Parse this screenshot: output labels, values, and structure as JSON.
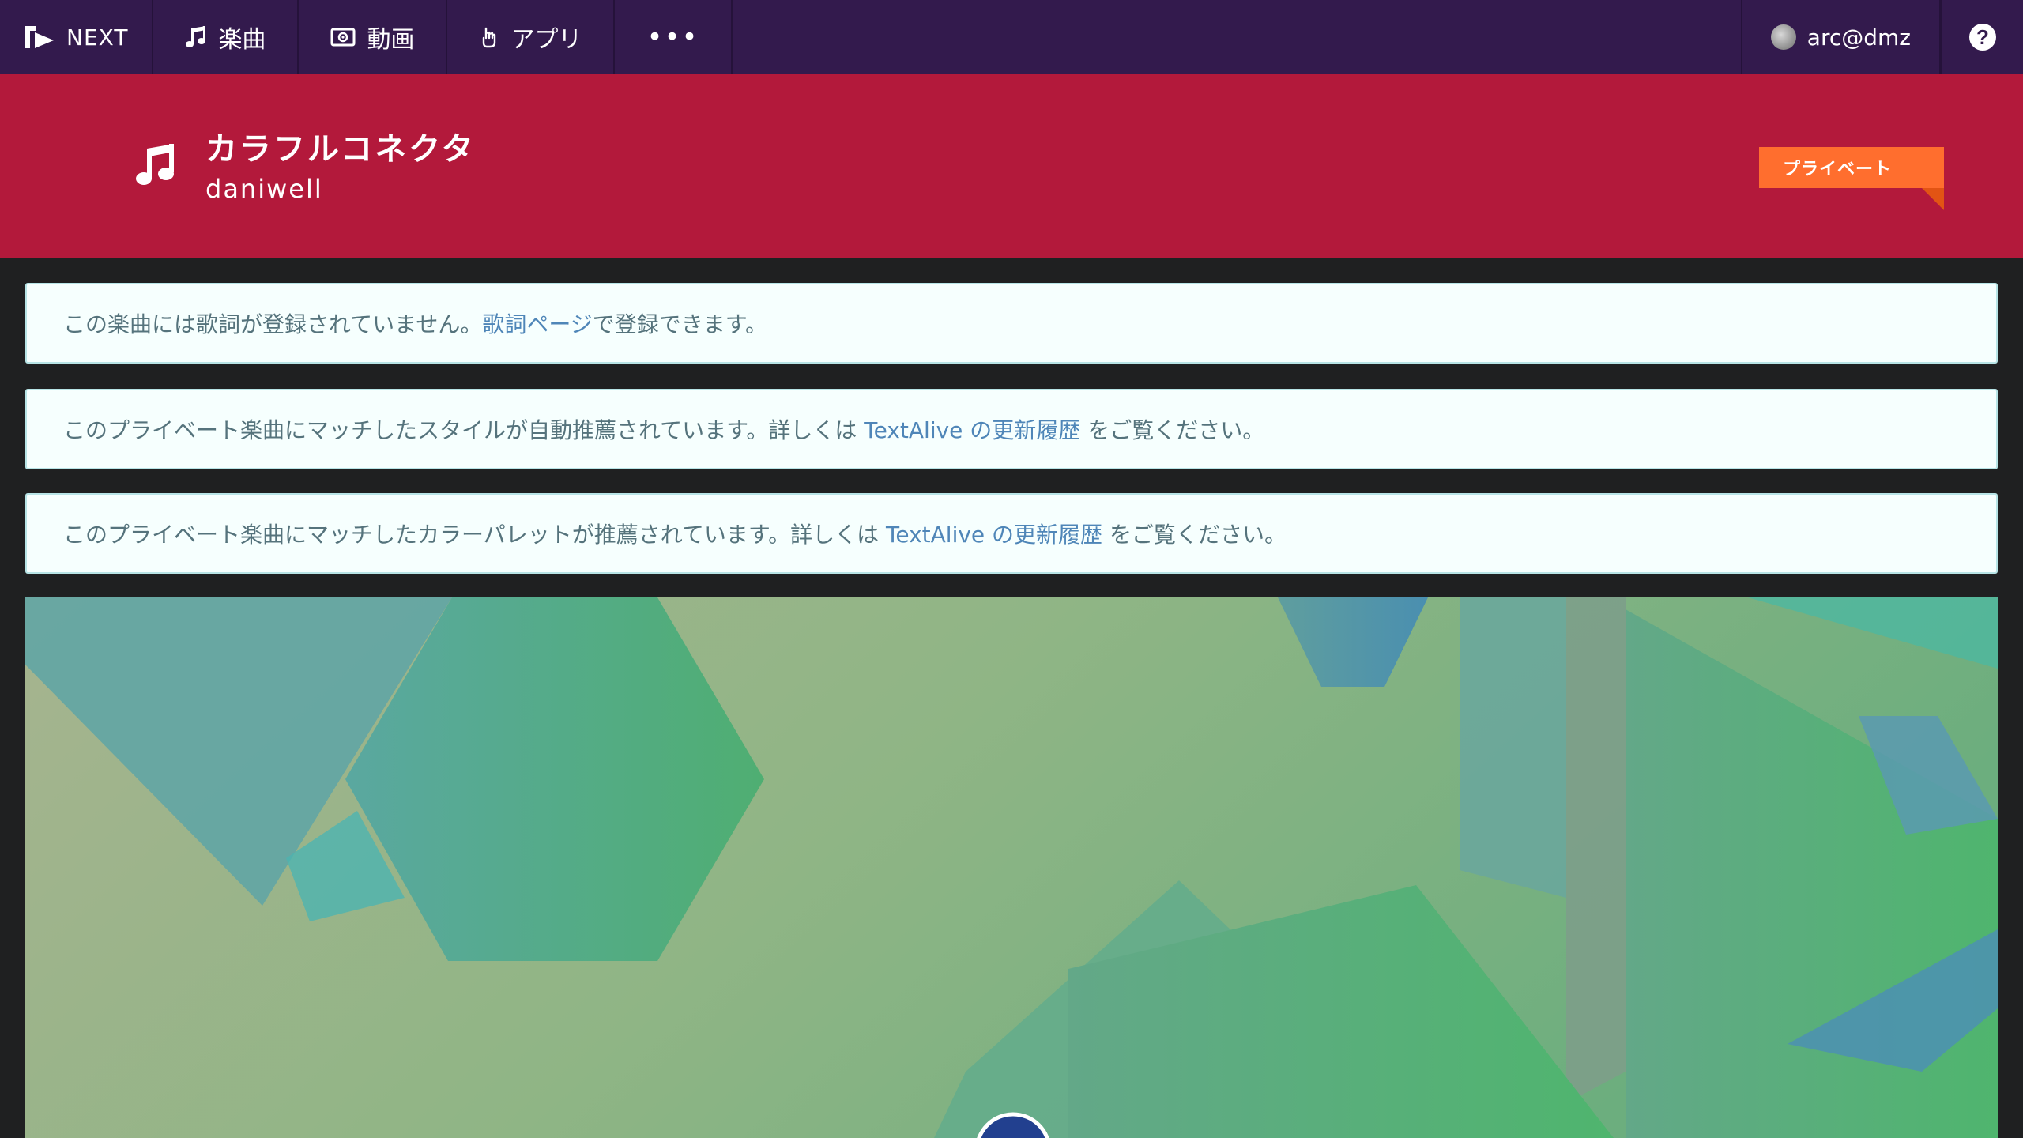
{
  "nav": {
    "brand_label": "NEXT",
    "songs_label": "楽曲",
    "videos_label": "動画",
    "apps_label": "アプリ",
    "more_label": "•••",
    "user_name": "arc@dmz",
    "help_label": "?"
  },
  "song": {
    "title": "カラフルコネクタ",
    "artist": "daniwell",
    "badge": "プライベート"
  },
  "notices": [
    {
      "before": "この楽曲には歌詞が登録されていません。",
      "link": "歌詞ページ",
      "after": "で登録できます。"
    },
    {
      "before": "このプライベート楽曲にマッチしたスタイルが自動推薦されています。詳しくは ",
      "link": "TextAlive の更新履歴",
      "after": " をご覧ください。"
    },
    {
      "before": "このプライベート楽曲にマッチしたカラーパレットが推薦されています。詳しくは ",
      "link": "TextAlive の更新履歴",
      "after": " をご覧ください。"
    }
  ],
  "colors": {
    "nav_bg": "#331a4d",
    "song_header_bg": "#b3193b",
    "badge_bg": "#ff6e2e",
    "link": "#4f86b8"
  },
  "icons": {
    "brand": "textalive-logo-icon",
    "songs": "music-note-icon",
    "videos": "video-icon",
    "apps": "app-hand-icon",
    "song_header": "music-note-icon",
    "help": "help-circle-icon"
  }
}
